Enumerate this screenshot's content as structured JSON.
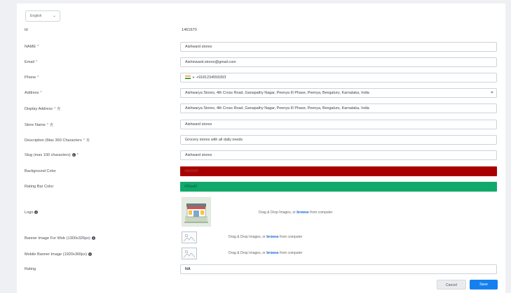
{
  "language": {
    "selected": "English"
  },
  "fields": {
    "id": {
      "label": "Id",
      "value": "1461670"
    },
    "name": {
      "label": "NAME",
      "req": "*",
      "value": "Aishward stores"
    },
    "email": {
      "label": "Email",
      "req": "*",
      "value": "Aishinward.stores@gmail.com"
    },
    "phone": {
      "label": "Phone",
      "req": "*",
      "value": "+918123455939З"
    },
    "address": {
      "label": "Address",
      "req": "*",
      "value": "Aishwarya Stores, 4th Cross Road, Ganapathy Nagar, Peenya III Phase, Peenya, Bengaluru, Karnataka, India"
    },
    "display_address": {
      "label": "Display Address",
      "req": "*",
      "value": "Aishwarya Stores, 4th Cross Road, Ganapathy Nagar, Peenya III Phase, Peenya, Bengaluru, Karnataka, India"
    },
    "store_name": {
      "label": "Store Name",
      "req": "*",
      "value": "Aishward stores"
    },
    "description": {
      "label": "Description (Max 360 Characters",
      "req": "*",
      "value": "Grocery stores with all daily needs"
    },
    "slug": {
      "label": "Slug (max 100 characters)",
      "req": "*",
      "value": "Aishward stores"
    },
    "background_color": {
      "label": "Background Color",
      "value": "#bb0000",
      "color": "#a80000"
    },
    "rating_bar_color": {
      "label": "Rating Bar Color",
      "value": "#00aa6f",
      "color": "#10a96b"
    },
    "logo": {
      "label": "Logo"
    },
    "banner_web": {
      "label": "Banner Image For Web (1300x326px)"
    },
    "banner_mobile": {
      "label": "Mobile Banner Image (1920x360px)"
    },
    "rating": {
      "label": "Rating",
      "value": "NA"
    }
  },
  "dropzone": {
    "prefix": "Drag & Drop Images, or",
    "browse": "browse",
    "suffix": "from computer"
  },
  "translate_icon": "translate-icon",
  "buttons": {
    "cancel": "Cancel",
    "save": "Save"
  }
}
